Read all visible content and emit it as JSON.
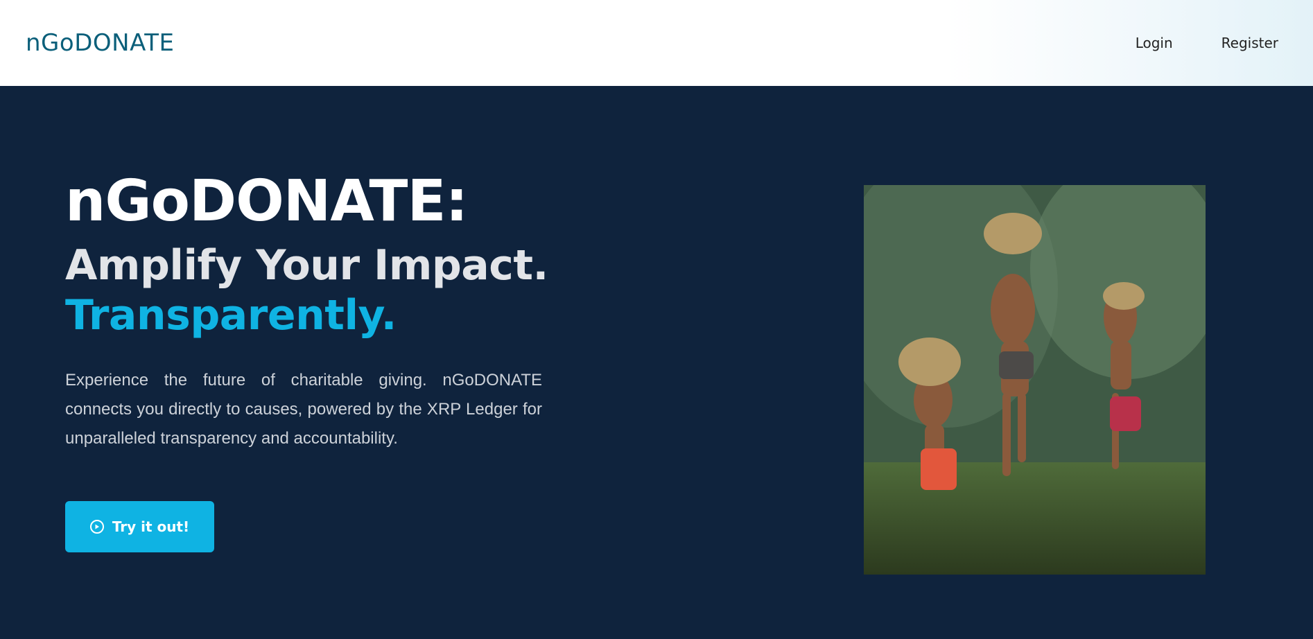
{
  "brand": {
    "logo": "nGoDONATE"
  },
  "nav": {
    "login": "Login",
    "register": "Register"
  },
  "hero": {
    "title": "nGoDONATE:",
    "subtitle": "Amplify Your Impact.",
    "subtitle_accent": "Transparently.",
    "description": "Experience the future of charitable giving. nGoDONATE connects you directly to causes, powered by the XRP Ledger for unparalleled transparency and accountability.",
    "cta_label": "Try it out!",
    "cta_icon": "play-circle-icon"
  },
  "colors": {
    "hero_bg": "#0f233d",
    "accent": "#0fb3e3",
    "logo": "#0b5f7a"
  }
}
